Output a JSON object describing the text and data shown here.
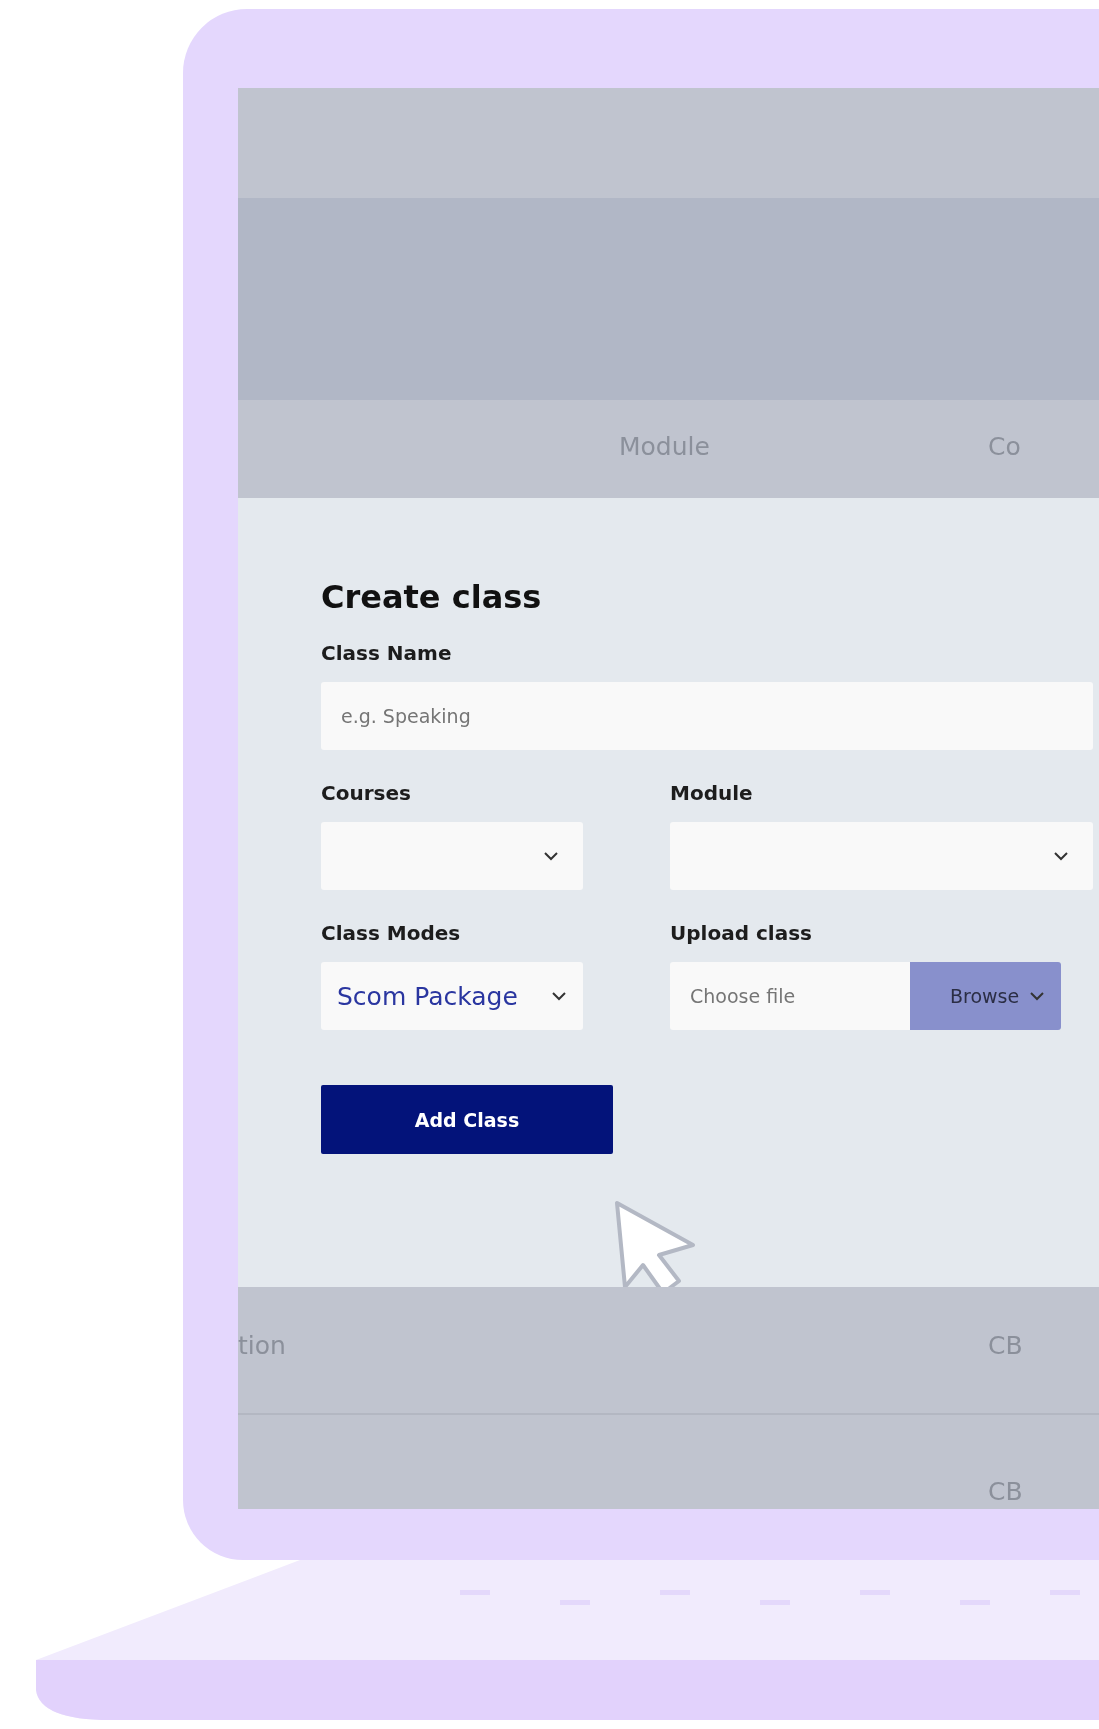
{
  "table_header": {
    "columns": [
      "Module",
      "Co"
    ]
  },
  "modal": {
    "title": "Create class",
    "fields": [
      {
        "kind": "text",
        "label": "Class Name",
        "placeholder": "e.g. Speaking"
      },
      {
        "kind": "select",
        "label": "Courses"
      },
      {
        "kind": "select",
        "label": "Module"
      },
      {
        "kind": "select",
        "label": "Class Modes",
        "value": "Scom Package"
      },
      {
        "kind": "file",
        "label": "Upload class",
        "placeholder": "Choose file",
        "button": "Browse"
      }
    ],
    "submit": "Add Class"
  },
  "table_rows": [
    {
      "column_1": "tion",
      "column_2": "CB"
    },
    {
      "column_2": "CB"
    }
  ]
}
